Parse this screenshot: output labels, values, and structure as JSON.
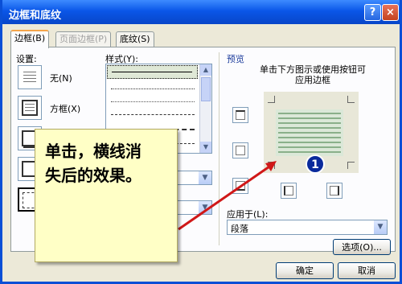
{
  "window": {
    "title": "边框和底纹",
    "help_label": "?",
    "close_label": "×"
  },
  "tabs": [
    {
      "label": "边框(B)"
    },
    {
      "label": "页面边框(P)"
    },
    {
      "label": "底纹(S)"
    }
  ],
  "settings": {
    "label": "设置:",
    "items": [
      {
        "label": "无(N)"
      },
      {
        "label": "方框(X)"
      },
      {
        "label": ""
      },
      {
        "label": ""
      },
      {
        "label": ""
      }
    ]
  },
  "style": {
    "label": "样式(Y):"
  },
  "preview": {
    "label": "预览",
    "hint": "单击下方图示或使用按钮可\n应用边框",
    "apply_to_label": "应用于(L):",
    "apply_to_value": "段落",
    "options_label": "选项(O)..."
  },
  "buttons": {
    "ok_label": "确定",
    "cancel_label": "取消"
  },
  "annotation": {
    "callout_text": "单击，横线消\n失后的效果。",
    "badge": "1"
  },
  "colors": {
    "titlebar": "#0a56e8",
    "callout_bg": "#ffffc6",
    "arrow": "#d01818",
    "badge": "#0a2a9c"
  }
}
